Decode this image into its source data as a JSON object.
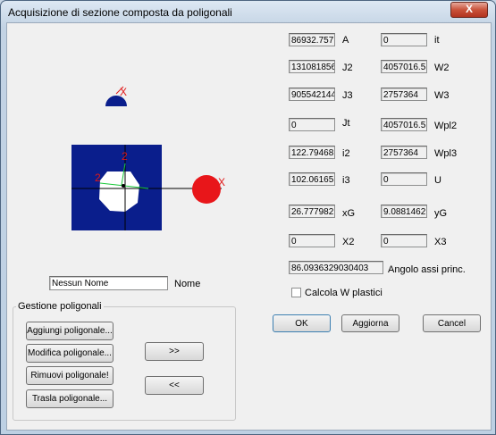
{
  "window": {
    "title": "Acquisizione di sezione composta da poligonali",
    "close_glyph": "X"
  },
  "drawing": {
    "axis_label_x": "X",
    "axis_label_2": "2"
  },
  "props": [
    {
      "value": "86932.757",
      "label": "A"
    },
    {
      "value": "131081856",
      "label": "J2"
    },
    {
      "value": "905542144",
      "label": "J3"
    },
    {
      "value": "0",
      "label": "Jt"
    },
    {
      "value": "122.79468",
      "label": "i2"
    },
    {
      "value": "102.06165",
      "label": "i3"
    },
    {
      "value": "26.777982",
      "label": "xG"
    },
    {
      "value": "0",
      "label": "X2"
    }
  ],
  "props_right": [
    {
      "value": "0",
      "label": "it"
    },
    {
      "value": "4057016.5",
      "label": "W2"
    },
    {
      "value": "2757364",
      "label": "W3"
    },
    {
      "value": "4057016.5",
      "label": "Wpl2"
    },
    {
      "value": "2757364",
      "label": "Wpl3"
    },
    {
      "value": "0",
      "label": "U"
    },
    {
      "value": "9.0881462",
      "label": "yG"
    },
    {
      "value": "0",
      "label": "X3"
    }
  ],
  "angle": {
    "value": "86.0936329030403",
    "label": "Angolo assi princ."
  },
  "plastic": {
    "label": "Calcola W plastici",
    "checked": false
  },
  "name": {
    "value": "Nessun Nome",
    "label": "Nome"
  },
  "group": {
    "label": "Gestione poligonali",
    "add": "Aggiungi poligonale...",
    "modify": "Modifica poligonale...",
    "remove": "Rimuovi poligonale!",
    "move": "Trasla poligonale...",
    "next": ">>",
    "prev": "<<"
  },
  "buttons": {
    "ok": "OK",
    "update": "Aggiorna",
    "cancel": "Cancel"
  },
  "colors": {
    "section_fill": "#0a1e8c",
    "hole": "#ffffff",
    "centroid_marker": "#e8161a",
    "axis": "#18c838",
    "label_red": "#e01818"
  }
}
